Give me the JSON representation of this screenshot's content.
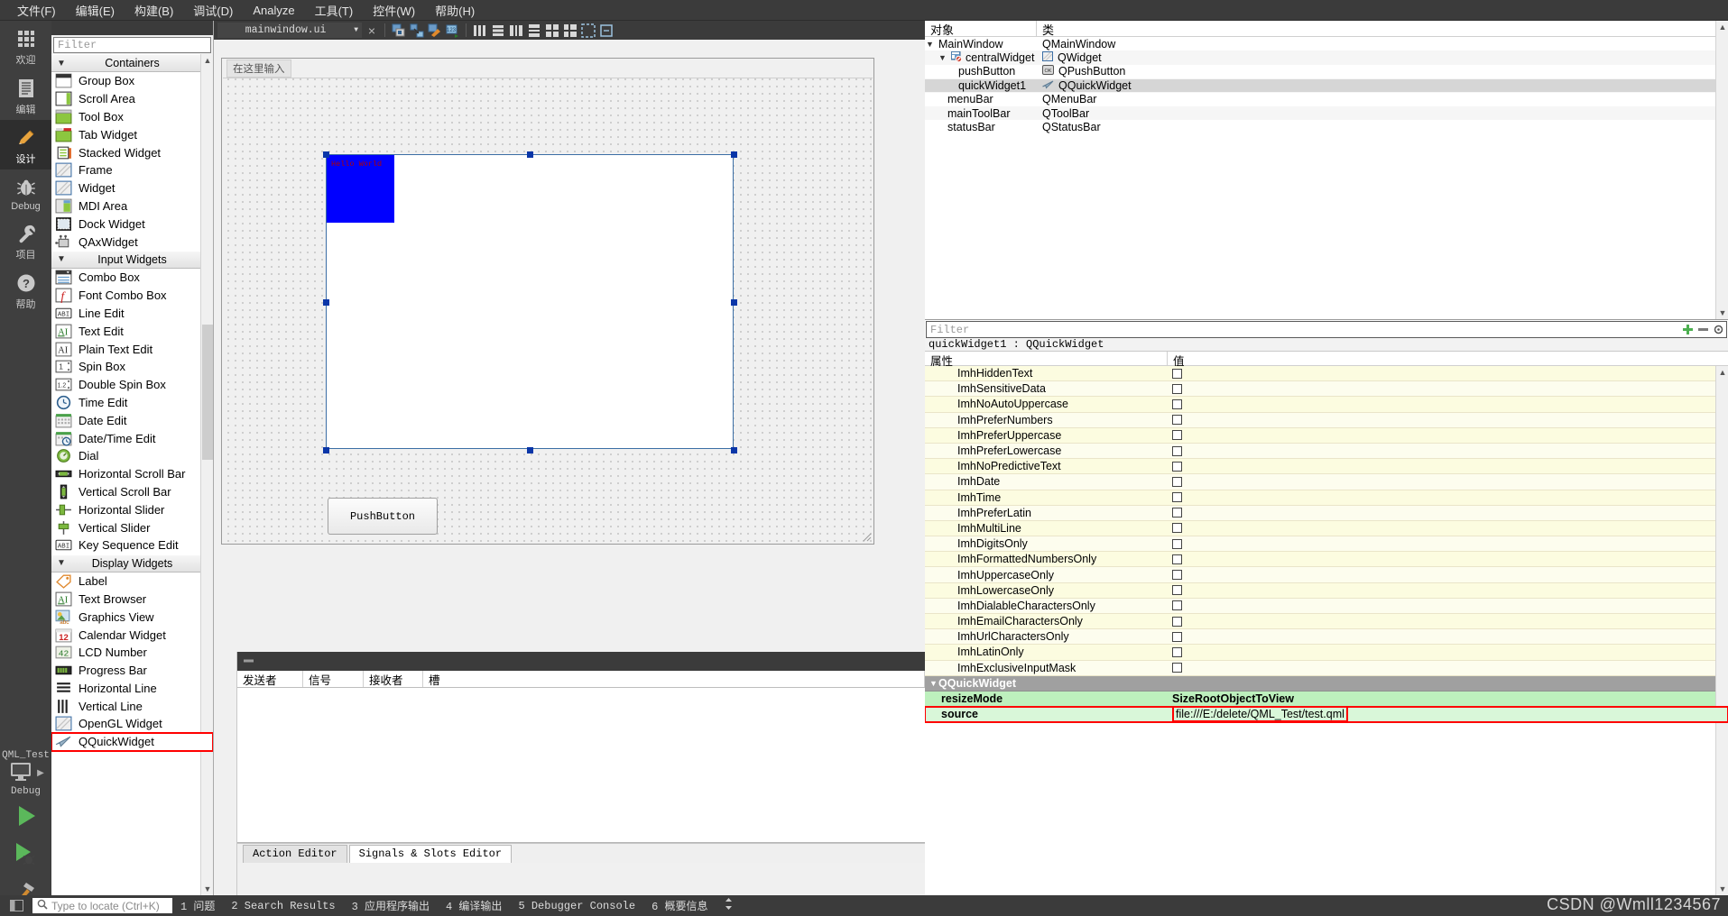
{
  "menubar": {
    "items": [
      "文件(F)",
      "编辑(E)",
      "构建(B)",
      "调试(D)",
      "Analyze",
      "工具(T)",
      "控件(W)",
      "帮助(H)"
    ]
  },
  "modebar": {
    "modes": [
      {
        "label": "欢迎",
        "icon": "grid-icon"
      },
      {
        "label": "编辑",
        "icon": "document-icon"
      },
      {
        "label": "设计",
        "icon": "pencil-icon"
      },
      {
        "label": "Debug",
        "icon": "bug-icon"
      },
      {
        "label": "项目",
        "icon": "wrench-icon"
      },
      {
        "label": "帮助",
        "icon": "question-icon"
      }
    ],
    "active_mode": "设计",
    "kit_name": "QML_Test",
    "kit_config": "Debug",
    "run_icon": "run-triangle-icon",
    "debug_icon": "debug-run-icon",
    "build_icon": "hammer-icon"
  },
  "widgetbox": {
    "filter_placeholder": "Filter",
    "categories": [
      {
        "name": "Containers",
        "items": [
          {
            "label": "Group Box",
            "icon": "group-box-icon"
          },
          {
            "label": "Scroll Area",
            "icon": "scroll-area-icon"
          },
          {
            "label": "Tool Box",
            "icon": "tool-box-icon"
          },
          {
            "label": "Tab Widget",
            "icon": "tab-widget-icon"
          },
          {
            "label": "Stacked Widget",
            "icon": "stacked-widget-icon"
          },
          {
            "label": "Frame",
            "icon": "frame-icon"
          },
          {
            "label": "Widget",
            "icon": "widget-icon"
          },
          {
            "label": "MDI Area",
            "icon": "mdi-area-icon"
          },
          {
            "label": "Dock Widget",
            "icon": "dock-widget-icon"
          },
          {
            "label": "QAxWidget",
            "icon": "qax-widget-icon"
          }
        ]
      },
      {
        "name": "Input Widgets",
        "items": [
          {
            "label": "Combo Box",
            "icon": "combo-box-icon"
          },
          {
            "label": "Font Combo Box",
            "icon": "font-combo-box-icon"
          },
          {
            "label": "Line Edit",
            "icon": "line-edit-icon"
          },
          {
            "label": "Text Edit",
            "icon": "text-edit-icon"
          },
          {
            "label": "Plain Text Edit",
            "icon": "plain-text-edit-icon"
          },
          {
            "label": "Spin Box",
            "icon": "spin-box-icon"
          },
          {
            "label": "Double Spin Box",
            "icon": "double-spin-box-icon"
          },
          {
            "label": "Time Edit",
            "icon": "time-edit-icon"
          },
          {
            "label": "Date Edit",
            "icon": "date-edit-icon"
          },
          {
            "label": "Date/Time Edit",
            "icon": "date-time-edit-icon"
          },
          {
            "label": "Dial",
            "icon": "dial-icon"
          },
          {
            "label": "Horizontal Scroll Bar",
            "icon": "h-scrollbar-icon"
          },
          {
            "label": "Vertical Scroll Bar",
            "icon": "v-scrollbar-icon"
          },
          {
            "label": "Horizontal Slider",
            "icon": "h-slider-icon"
          },
          {
            "label": "Vertical Slider",
            "icon": "v-slider-icon"
          },
          {
            "label": "Key Sequence Edit",
            "icon": "key-sequence-edit-icon"
          }
        ]
      },
      {
        "name": "Display Widgets",
        "items": [
          {
            "label": "Label",
            "icon": "label-icon"
          },
          {
            "label": "Text Browser",
            "icon": "text-browser-icon"
          },
          {
            "label": "Graphics View",
            "icon": "graphics-view-icon"
          },
          {
            "label": "Calendar Widget",
            "icon": "calendar-widget-icon"
          },
          {
            "label": "LCD Number",
            "icon": "lcd-number-icon"
          },
          {
            "label": "Progress Bar",
            "icon": "progress-bar-icon"
          },
          {
            "label": "Horizontal Line",
            "icon": "h-line-icon"
          },
          {
            "label": "Vertical Line",
            "icon": "v-line-icon"
          },
          {
            "label": "OpenGL Widget",
            "icon": "opengl-widget-icon"
          },
          {
            "label": "QQuickWidget",
            "icon": "qquick-widget-icon"
          }
        ]
      }
    ],
    "highlighted_item": "QQuickWidget",
    "highlight_color": "#ff0000"
  },
  "form_editor": {
    "file_name": "mainwindow.ui",
    "close_label": "×",
    "toolbar_icons": [
      "edit-widgets-icon",
      "edit-signals-slots-icon",
      "edit-buddies-icon",
      "edit-tab-order-icon",
      "layout-horizontally-icon",
      "layout-vertically-icon",
      "layout-splitter-h-icon",
      "layout-splitter-v-icon",
      "layout-grid-icon",
      "layout-form-icon",
      "break-layout-icon",
      "adjust-size-icon"
    ],
    "canvas": {
      "menu_placeholder": "在这里输入",
      "quick_widget_text": "Hello World",
      "quick_widget_bg": "#0000ff",
      "push_button_label": "PushButton",
      "selection_color": "#0a36a8"
    }
  },
  "signal_slot_editor": {
    "add_label": "+",
    "remove_label": "—",
    "columns": [
      "发送者",
      "信号",
      "接收者",
      "槽"
    ],
    "rows": [],
    "tabs": [
      {
        "label": "Action Editor",
        "active": false
      },
      {
        "label": "Signals & Slots Editor",
        "active": true
      }
    ]
  },
  "object_inspector": {
    "columns": [
      "对象",
      "类"
    ],
    "rows": [
      {
        "name": "MainWindow",
        "class": "QMainWindow",
        "indent": 0,
        "expander": "v",
        "icon": "",
        "selected": false
      },
      {
        "name": "centralWidget",
        "class": "QWidget",
        "indent": 1,
        "expander": "v",
        "icon": "central-widget-icon",
        "selected": false
      },
      {
        "name": "pushButton",
        "class": "QPushButton",
        "indent": 2,
        "expander": "",
        "icon": "push-button-icon",
        "selected": false
      },
      {
        "name": "quickWidget1",
        "class": "QQuickWidget",
        "indent": 2,
        "expander": "",
        "icon": "qquick-widget-icon",
        "selected": true
      },
      {
        "name": "menuBar",
        "class": "QMenuBar",
        "indent": 1,
        "expander": "",
        "icon": "",
        "selected": false
      },
      {
        "name": "mainToolBar",
        "class": "QToolBar",
        "indent": 1,
        "expander": "",
        "icon": "",
        "selected": false
      },
      {
        "name": "statusBar",
        "class": "QStatusBar",
        "indent": 1,
        "expander": "",
        "icon": "",
        "selected": false
      }
    ]
  },
  "property_editor": {
    "filter_placeholder": "Filter",
    "object_line": "quickWidget1 : QQuickWidget",
    "columns": [
      "属性",
      "值"
    ],
    "add_icon": "plus-icon",
    "remove_icon": "minus-icon",
    "config_icon": "configure-icon",
    "rows": [
      {
        "name": "ImhHiddenText",
        "value": "",
        "kind": "checkbox"
      },
      {
        "name": "ImhSensitiveData",
        "value": "",
        "kind": "checkbox"
      },
      {
        "name": "ImhNoAutoUppercase",
        "value": "",
        "kind": "checkbox"
      },
      {
        "name": "ImhPreferNumbers",
        "value": "",
        "kind": "checkbox"
      },
      {
        "name": "ImhPreferUppercase",
        "value": "",
        "kind": "checkbox"
      },
      {
        "name": "ImhPreferLowercase",
        "value": "",
        "kind": "checkbox"
      },
      {
        "name": "ImhNoPredictiveText",
        "value": "",
        "kind": "checkbox"
      },
      {
        "name": "ImhDate",
        "value": "",
        "kind": "checkbox"
      },
      {
        "name": "ImhTime",
        "value": "",
        "kind": "checkbox"
      },
      {
        "name": "ImhPreferLatin",
        "value": "",
        "kind": "checkbox"
      },
      {
        "name": "ImhMultiLine",
        "value": "",
        "kind": "checkbox"
      },
      {
        "name": "ImhDigitsOnly",
        "value": "",
        "kind": "checkbox"
      },
      {
        "name": "ImhFormattedNumbersOnly",
        "value": "",
        "kind": "checkbox"
      },
      {
        "name": "ImhUppercaseOnly",
        "value": "",
        "kind": "checkbox"
      },
      {
        "name": "ImhLowercaseOnly",
        "value": "",
        "kind": "checkbox"
      },
      {
        "name": "ImhDialableCharactersOnly",
        "value": "",
        "kind": "checkbox"
      },
      {
        "name": "ImhEmailCharactersOnly",
        "value": "",
        "kind": "checkbox"
      },
      {
        "name": "ImhUrlCharactersOnly",
        "value": "",
        "kind": "checkbox"
      },
      {
        "name": "ImhLatinOnly",
        "value": "",
        "kind": "checkbox"
      },
      {
        "name": "ImhExclusiveInputMask",
        "value": "",
        "kind": "checkbox"
      }
    ],
    "group_header": "QQuickWidget",
    "group_rows": [
      {
        "name": "resizeMode",
        "value": "SizeRootObjectToView",
        "highlighted": false
      },
      {
        "name": "source",
        "value": "file:///E:/delete/QML_Test/test.qml",
        "highlighted": true
      }
    ],
    "highlight_color": "#ff0000"
  },
  "statusbar": {
    "locate_placeholder": "Type to locate (Ctrl+K)",
    "search_icon": "search-icon",
    "panel_icon": "output-pane-toggle-icon",
    "items": [
      "1 问题",
      "2 Search Results",
      "3 应用程序输出",
      "4 编译输出",
      "5 Debugger Console",
      "6 概要信息"
    ],
    "updown_icon": "up-down-arrow-icon"
  },
  "watermark": "CSDN @Wmll1234567"
}
